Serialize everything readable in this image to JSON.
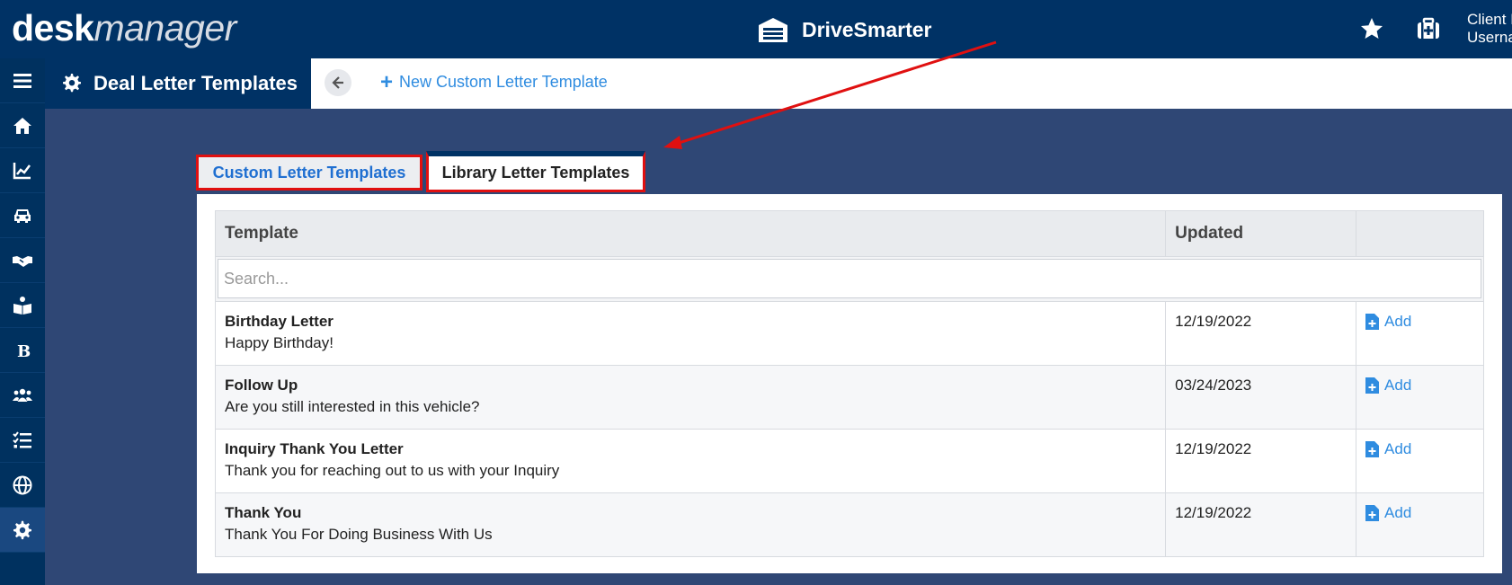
{
  "header": {
    "logo_bold": "desk",
    "logo_italic": "manager",
    "brand_name": "DriveSmarter",
    "client_line1": "Client I",
    "client_line2": "Userna"
  },
  "pagebar": {
    "title": "Deal Letter Templates",
    "new_link": "New Custom Letter Template"
  },
  "tabs": {
    "custom": "Custom Letter Templates",
    "library": "Library Letter Templates"
  },
  "table": {
    "headers": [
      "Template",
      "Updated",
      ""
    ],
    "search_placeholder": "Search...",
    "rows": [
      {
        "name": "Birthday Letter",
        "subject": "Happy Birthday!",
        "updated": "12/19/2022",
        "action": "Add"
      },
      {
        "name": "Follow Up",
        "subject": "Are you still interested in this vehicle?",
        "updated": "03/24/2023",
        "action": "Add"
      },
      {
        "name": "Inquiry Thank You Letter",
        "subject": "Thank you for reaching out to us with your Inquiry",
        "updated": "12/19/2022",
        "action": "Add"
      },
      {
        "name": "Thank You",
        "subject": "Thank You For Doing Business With Us",
        "updated": "12/19/2022",
        "action": "Add"
      }
    ]
  },
  "sidebar_icons": [
    "menu-icon",
    "home-icon",
    "chart-icon",
    "car-icon",
    "handshake-icon",
    "book-icon",
    "bold-b-icon",
    "users-icon",
    "checklist-icon",
    "globe-icon",
    "gear-icon"
  ],
  "colors": {
    "header_bg": "#003265",
    "content_bg": "#2f4775",
    "link_blue": "#2f8ce0",
    "highlight_red": "#e01010"
  }
}
